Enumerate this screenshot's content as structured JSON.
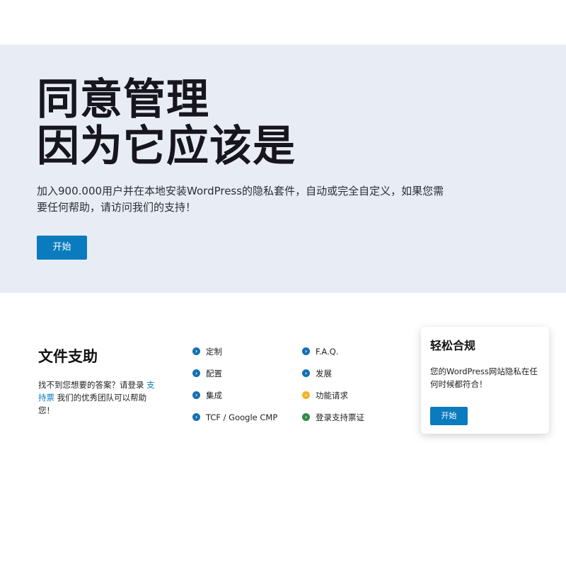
{
  "hero": {
    "title_line1": "同意管理",
    "title_line2": "因为它应该是",
    "description": "加入900.000用户并在本地安装WordPress的隐私套件，自动或完全自定义，如果您需要任何帮助，请访问我们的支持！",
    "start_button": "开始"
  },
  "docs": {
    "title": "文件支助",
    "desc_before": "找不到您想要的答案？请登录 ",
    "desc_link": "支持票",
    "desc_after": " 我们的优秀团队可以帮助您！"
  },
  "links": {
    "column1": [
      {
        "label": "定制",
        "icon": "chevron-right-circle-icon",
        "color": "#1570b3"
      },
      {
        "label": "配置",
        "icon": "chevron-right-circle-icon",
        "color": "#1570b3"
      },
      {
        "label": "集成",
        "icon": "chevron-right-circle-icon",
        "color": "#1570b3"
      },
      {
        "label": "TCF / Google CMP",
        "icon": "chevron-right-circle-icon",
        "color": "#1570b3"
      }
    ],
    "column2": [
      {
        "label": "F.A.Q.",
        "icon": "chevron-right-circle-icon",
        "color": "#1570b3"
      },
      {
        "label": "发展",
        "icon": "chevron-right-circle-icon",
        "color": "#1570b3"
      },
      {
        "label": "功能请求",
        "icon": "chevron-right-circle-icon",
        "color": "#f0b429"
      },
      {
        "label": "登录支持票证",
        "icon": "chevron-right-circle-icon",
        "color": "#2f8a46"
      }
    ]
  },
  "card": {
    "title": "轻松合规",
    "description": "您的WordPress网站隐私在任何时候都符合！",
    "button": "开始"
  },
  "colors": {
    "hero_background": "#e8edf5",
    "accent": "#0a7bbf"
  }
}
